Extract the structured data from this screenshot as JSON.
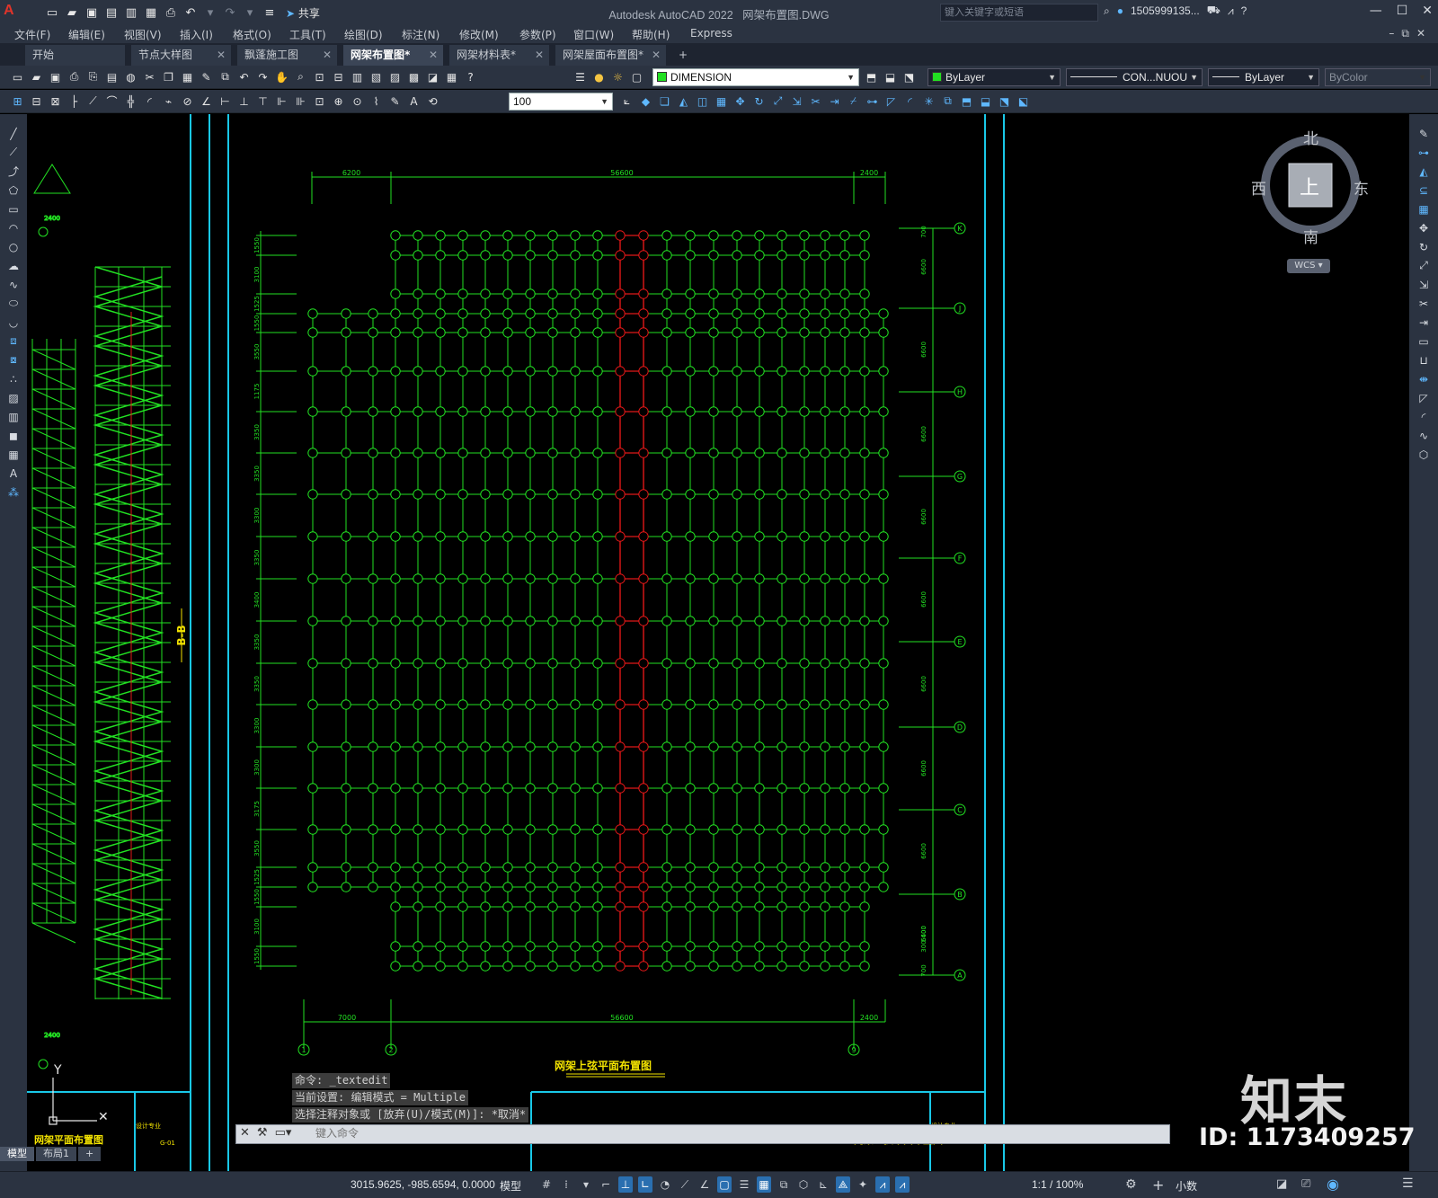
{
  "app": {
    "title": "Autodesk AutoCAD 2022",
    "file": "网架布置图.DWG",
    "logo": "A",
    "share": "共享",
    "search_placeholder": "键入关键字或短语",
    "user": "1505999135...",
    "colors": {
      "titlebar": "#2b3341",
      "drawing_bg": "#000000",
      "line_green": "#22e022",
      "frame_cyan": "#19c8e8",
      "highlight_red": "#e01818",
      "text_yellow": "#f2e200"
    }
  },
  "menu": [
    "文件(F)",
    "编辑(E)",
    "视图(V)",
    "插入(I)",
    "格式(O)",
    "工具(T)",
    "绘图(D)",
    "标注(N)",
    "修改(M)",
    "参数(P)",
    "窗口(W)",
    "帮助(H)",
    "Express"
  ],
  "tabs": [
    {
      "label": "开始",
      "closable": false,
      "active": false
    },
    {
      "label": "节点大样图",
      "closable": true,
      "active": false
    },
    {
      "label": "飘蓬施工图",
      "closable": true,
      "active": false
    },
    {
      "label": "网架布置图*",
      "closable": true,
      "active": true
    },
    {
      "label": "网架材料表*",
      "closable": true,
      "active": false
    },
    {
      "label": "网架屋面布置图*",
      "closable": true,
      "active": false
    }
  ],
  "toolbar": {
    "layer": "DIMENSION",
    "color": "ByLayer",
    "linetype": "CON...NUOU",
    "lineweight": "ByLayer",
    "plotstyle": "ByColor",
    "zoom_value": "100"
  },
  "viewcube": {
    "north": "北",
    "south": "南",
    "east": "东",
    "west": "西",
    "face": "上",
    "wcs": "WCS"
  },
  "drawing": {
    "main_title": "网架上弦平面布置图",
    "left_title": "网架平面布置图",
    "section_label": "B-B",
    "title_block_label": "设计专业",
    "title_block_code": "G-01",
    "axis_y": "Y",
    "top_dims": [
      "6200",
      "56600",
      "2400"
    ],
    "bottom_dims": [
      "7000",
      "56600",
      "2400"
    ],
    "bottom_axis_labels": [
      "1",
      "2",
      "9"
    ],
    "right_axis_labels": [
      "K",
      "J",
      "H",
      "G",
      "F",
      "E",
      "D",
      "C",
      "B",
      "A"
    ],
    "left_pitch_labels": [
      "1550",
      "3100",
      "1525",
      "1550",
      "3550",
      "1175",
      "3350",
      "3350",
      "3300",
      "3350",
      "3400",
      "3350",
      "3350",
      "3300",
      "3300",
      "3175",
      "3550",
      "1525",
      "1550",
      "3100",
      "1550"
    ],
    "right_span_labels": [
      "700",
      "6600",
      "6600",
      "6600",
      "6600",
      "6600",
      "6600",
      "6600",
      "6600",
      "6600",
      "300",
      "6400",
      "700"
    ],
    "left_detail_dims": [
      "2400",
      "2400"
    ]
  },
  "command": {
    "history": [
      "命令: _textedit",
      "当前设置: 编辑模式 = Multiple",
      "选择注释对象或 [放弃(U)/模式(M)]: *取消*"
    ],
    "placeholder": "键入命令"
  },
  "status": {
    "layouts": [
      "模型",
      "布局1"
    ],
    "coords": "3015.9625, -985.6594, 0.0000",
    "space": "模型",
    "scale": "1:1 / 100%",
    "units": "小数"
  },
  "watermark": {
    "logo": "知末",
    "id": "ID: 1173409257"
  }
}
